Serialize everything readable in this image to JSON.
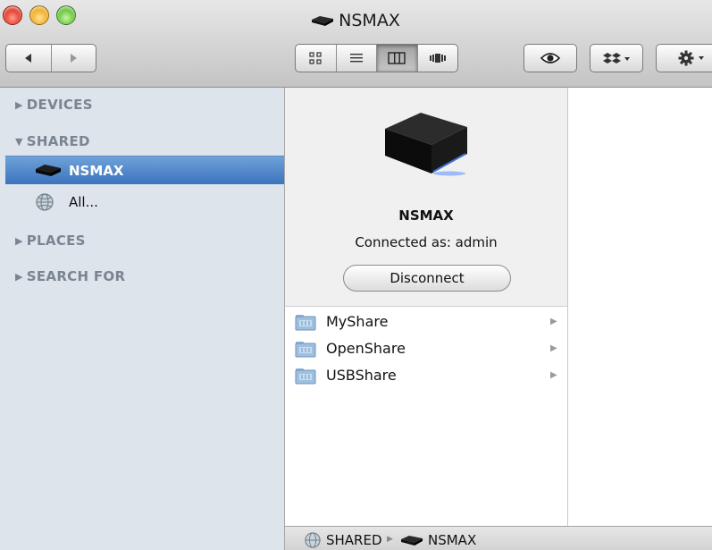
{
  "window": {
    "title": "NSMAX"
  },
  "toolbar": {
    "back_icon": "back-arrow-icon",
    "forward_icon": "forward-arrow-icon",
    "view_modes": [
      "icon-view",
      "list-view",
      "column-view",
      "cover-flow-view"
    ],
    "active_view": "column-view",
    "quick_look_icon": "eye-icon",
    "dropbox_icon": "dropbox-icon",
    "action_icon": "gear-icon"
  },
  "sidebar": {
    "sections": [
      {
        "label": "DEVICES",
        "expanded": false
      },
      {
        "label": "SHARED",
        "expanded": true
      },
      {
        "label": "PLACES",
        "expanded": false
      },
      {
        "label": "SEARCH FOR",
        "expanded": false
      }
    ],
    "shared_items": [
      {
        "label": "NSMAX",
        "icon": "nas-drive-icon",
        "selected": true
      },
      {
        "label": "All...",
        "icon": "network-globe-icon",
        "selected": false
      }
    ]
  },
  "info": {
    "device_name": "NSMAX",
    "connected_as": "Connected as: admin",
    "disconnect_label": "Disconnect"
  },
  "shares": [
    {
      "label": "MyShare"
    },
    {
      "label": "OpenShare"
    },
    {
      "label": "USBShare"
    }
  ],
  "pathbar": {
    "items": [
      {
        "label": "SHARED",
        "icon": "network-globe-icon"
      },
      {
        "label": "NSMAX",
        "icon": "nas-drive-icon"
      }
    ]
  },
  "colors": {
    "sidebar_bg": "#dde4eb",
    "selection": "#3c74be",
    "section_header": "#7a8591"
  }
}
